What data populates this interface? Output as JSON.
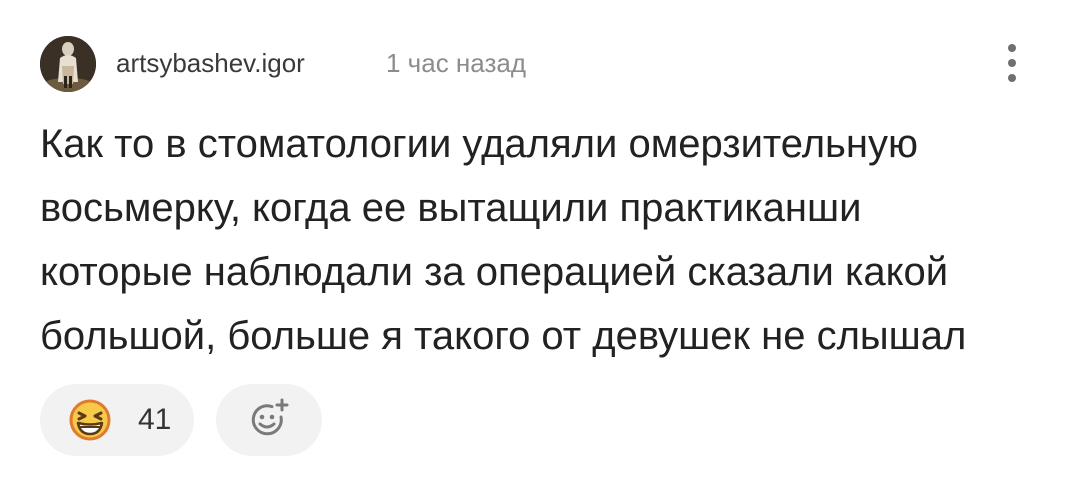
{
  "comment": {
    "username": "artsybashev.igor",
    "timestamp": "1 час назад",
    "text_lines": [
      "Как то в стоматологии удаляли омерзительную",
      "восьмерку, когда ее вытащили практиканши",
      "которые наблюдали за операцией сказали какой",
      "большой, больше я такого от девушек не слышал"
    ],
    "reaction": {
      "emoji_icon": "grinning-squinting-face-icon",
      "count": "41"
    },
    "add_reaction_icon": "smiley-plus-icon",
    "more_icon": "vertical-ellipsis-icon"
  },
  "colors": {
    "emoji_yellow": "#f7c949",
    "emoji_outline": "#e07a2e",
    "pill_background": "#f2f2f2",
    "muted_text": "#8c8c8c",
    "icon_gray": "#7a7a7a"
  }
}
